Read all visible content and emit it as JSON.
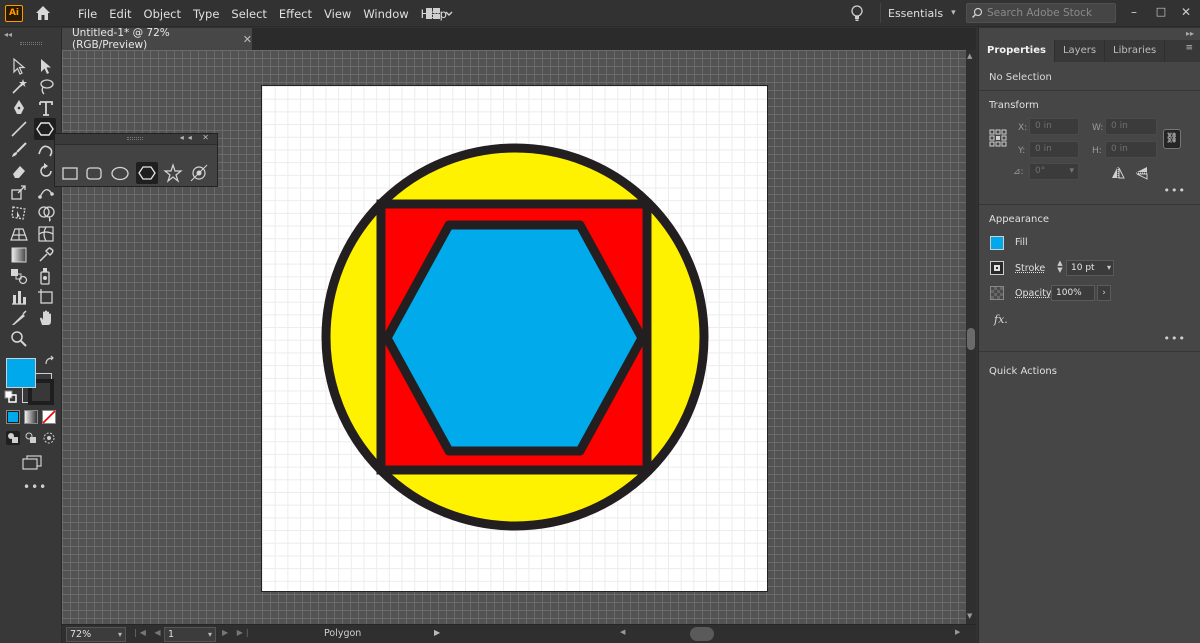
{
  "app": {
    "logo_text": "Ai",
    "menus": [
      "File",
      "Edit",
      "Object",
      "Type",
      "Select",
      "Effect",
      "View",
      "Window",
      "Help"
    ],
    "workspace": "Essentials",
    "search_placeholder": "Search Adobe Stock",
    "window_controls": [
      "–",
      "□",
      "✕"
    ]
  },
  "document": {
    "tab_title": "Untitled-1* @ 72% (RGB/Preview)",
    "tab_close": "✕"
  },
  "status_bar": {
    "zoom": "72%",
    "page": "1",
    "current_tool": "Polygon"
  },
  "toolbar": {
    "fill_color": "#00a9ec",
    "stroke_color": "#1e1e1e"
  },
  "artwork": {
    "circle_fill": "#fff200",
    "square_fill": "#ff0000",
    "hexagon_fill": "#00aaeb",
    "outline_color": "#231f20"
  },
  "properties_panel": {
    "tabs": [
      "Properties",
      "Layers",
      "Libraries"
    ],
    "active_tab": "Properties",
    "selection_label": "No Selection",
    "transform": {
      "title": "Transform",
      "x_label": "X:",
      "x_value": "0 in",
      "y_label": "Y:",
      "y_value": "0 in",
      "w_label": "W:",
      "w_value": "0 in",
      "h_label": "H:",
      "h_value": "0 in",
      "angle_label": "⊿:",
      "angle_value": "0°"
    },
    "appearance": {
      "title": "Appearance",
      "fill_label": "Fill",
      "stroke_label": "Stroke",
      "stroke_weight": "10 pt",
      "opacity_label": "Opacity",
      "opacity_value": "100%",
      "fx_label": "fx."
    },
    "quick_actions_title": "Quick Actions"
  }
}
